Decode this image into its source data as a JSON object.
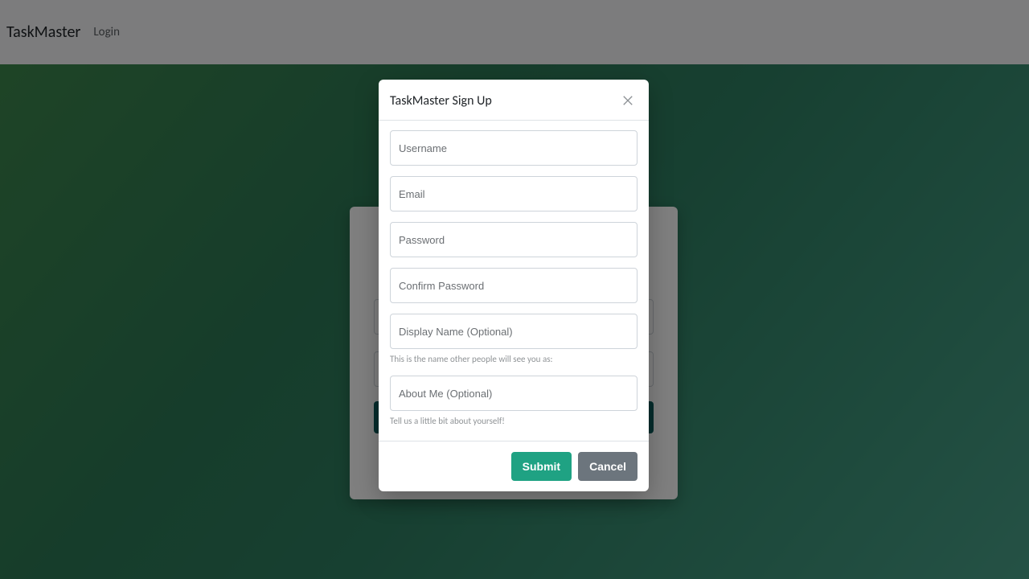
{
  "navbar": {
    "brand": "TaskMaster",
    "login_link": "Login"
  },
  "modal": {
    "title": "TaskMaster Sign Up",
    "fields": {
      "username_placeholder": "Username",
      "email_placeholder": "Email",
      "password_placeholder": "Password",
      "confirm_password_placeholder": "Confirm Password",
      "display_name_placeholder": "Display Name (Optional)",
      "display_name_help": "This is the name other people will see you as:",
      "about_me_placeholder": "About Me (Optional)",
      "about_me_help": "Tell us a little bit about yourself!"
    },
    "buttons": {
      "submit": "Submit",
      "cancel": "Cancel"
    }
  }
}
